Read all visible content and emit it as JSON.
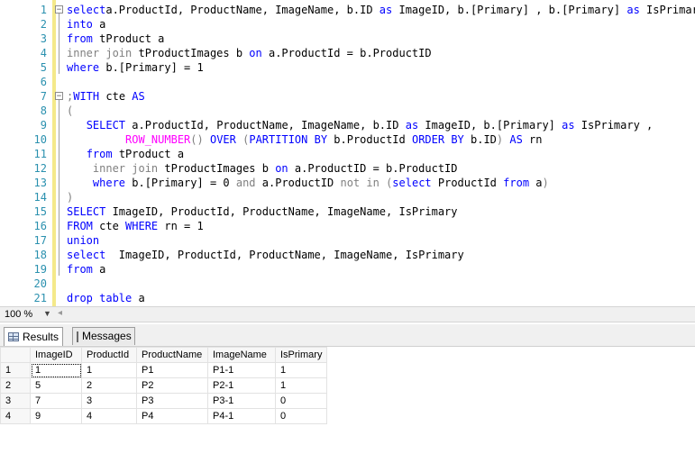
{
  "editor": {
    "lines": [
      {
        "num": "1",
        "fold": "−",
        "segs": [
          [
            "kw",
            "select"
          ],
          [
            "",
            "a.ProductId, ProductName, ImageName, b.ID "
          ],
          [
            "kw",
            "as"
          ],
          [
            "",
            " ImageID, b.[Primary] , b.[Primary] "
          ],
          [
            "kw",
            "as"
          ],
          [
            "",
            " IsPrimary"
          ]
        ]
      },
      {
        "num": "2",
        "segs": [
          [
            "kw",
            "into"
          ],
          [
            "",
            " a"
          ]
        ]
      },
      {
        "num": "3",
        "segs": [
          [
            "kw",
            "from"
          ],
          [
            "",
            " tProduct a"
          ]
        ]
      },
      {
        "num": "4",
        "segs": [
          [
            "gr",
            "inner join"
          ],
          [
            "",
            " tProductImages b "
          ],
          [
            "kw",
            "on"
          ],
          [
            "",
            " a.ProductId = b.ProductID"
          ]
        ]
      },
      {
        "num": "5",
        "segs": [
          [
            "kw",
            "where"
          ],
          [
            "",
            " b.[Primary] = 1"
          ]
        ]
      },
      {
        "num": "6",
        "segs": []
      },
      {
        "num": "7",
        "fold": "−",
        "segs": [
          [
            "gr",
            ";"
          ],
          [
            "kw",
            "WITH"
          ],
          [
            "",
            " cte "
          ],
          [
            "kw",
            "AS"
          ]
        ]
      },
      {
        "num": "8",
        "segs": [
          [
            "gr",
            "("
          ]
        ]
      },
      {
        "num": "9",
        "segs": [
          [
            "",
            "   "
          ],
          [
            "kw",
            "SELECT"
          ],
          [
            "",
            " a.ProductId, ProductName, ImageName, b.ID "
          ],
          [
            "kw",
            "as"
          ],
          [
            "",
            " ImageID, b.[Primary] "
          ],
          [
            "kw",
            "as"
          ],
          [
            "",
            " IsPrimary ,"
          ]
        ]
      },
      {
        "num": "10",
        "segs": [
          [
            "",
            "         "
          ],
          [
            "pk",
            "ROW_NUMBER"
          ],
          [
            "gr",
            "()"
          ],
          [
            "",
            " "
          ],
          [
            "kw",
            "OVER"
          ],
          [
            "",
            " "
          ],
          [
            "gr",
            "("
          ],
          [
            "kw",
            "PARTITION BY"
          ],
          [
            "",
            " b.ProductId "
          ],
          [
            "kw",
            "ORDER BY"
          ],
          [
            "",
            " b.ID"
          ],
          [
            "gr",
            ")"
          ],
          [
            "",
            " "
          ],
          [
            "kw",
            "AS"
          ],
          [
            "",
            " rn"
          ]
        ]
      },
      {
        "num": "11",
        "segs": [
          [
            "",
            "   "
          ],
          [
            "kw",
            "from"
          ],
          [
            "",
            " tProduct a"
          ]
        ]
      },
      {
        "num": "12",
        "segs": [
          [
            "",
            "    "
          ],
          [
            "gr",
            "inner join"
          ],
          [
            "",
            " tProductImages b "
          ],
          [
            "kw",
            "on"
          ],
          [
            "",
            " a.ProductID = b.ProductID"
          ]
        ]
      },
      {
        "num": "13",
        "segs": [
          [
            "",
            "    "
          ],
          [
            "kw",
            "where"
          ],
          [
            "",
            " b.[Primary] = 0 "
          ],
          [
            "gr",
            "and"
          ],
          [
            "",
            " a.ProductID "
          ],
          [
            "gr",
            "not in"
          ],
          [
            "",
            " "
          ],
          [
            "gr",
            "("
          ],
          [
            "kw",
            "select"
          ],
          [
            "",
            " ProductId "
          ],
          [
            "kw",
            "from"
          ],
          [
            "",
            " a"
          ],
          [
            "gr",
            ")"
          ]
        ]
      },
      {
        "num": "14",
        "segs": [
          [
            "gr",
            ")"
          ]
        ]
      },
      {
        "num": "15",
        "segs": [
          [
            "kw",
            "SELECT"
          ],
          [
            "",
            " ImageID, ProductId, ProductName, ImageName, IsPrimary"
          ]
        ]
      },
      {
        "num": "16",
        "segs": [
          [
            "kw",
            "FROM"
          ],
          [
            "",
            " cte "
          ],
          [
            "kw",
            "WHERE"
          ],
          [
            "",
            " rn = 1"
          ]
        ]
      },
      {
        "num": "17",
        "segs": [
          [
            "kw",
            "union"
          ]
        ]
      },
      {
        "num": "18",
        "segs": [
          [
            "kw",
            "select"
          ],
          [
            "",
            "  ImageID, ProductId, ProductName, ImageName, IsPrimary"
          ]
        ]
      },
      {
        "num": "19",
        "segs": [
          [
            "kw",
            "from"
          ],
          [
            "",
            " a"
          ]
        ]
      },
      {
        "num": "20",
        "segs": []
      },
      {
        "num": "21",
        "segs": [
          [
            "kw",
            "drop table"
          ],
          [
            "",
            " a"
          ]
        ]
      }
    ]
  },
  "status": {
    "zoom": "100 %"
  },
  "tabs": {
    "results": "Results",
    "messages": "Messages"
  },
  "results": {
    "columns": [
      "ImageID",
      "ProductId",
      "ProductName",
      "ImageName",
      "IsPrimary"
    ],
    "rows": [
      {
        "n": "1",
        "cells": [
          "1",
          "1",
          "P1",
          "P1-1",
          "1"
        ]
      },
      {
        "n": "2",
        "cells": [
          "5",
          "2",
          "P2",
          "P2-1",
          "1"
        ]
      },
      {
        "n": "3",
        "cells": [
          "7",
          "3",
          "P3",
          "P3-1",
          "0"
        ]
      },
      {
        "n": "4",
        "cells": [
          "9",
          "4",
          "P4",
          "P4-1",
          "0"
        ]
      }
    ]
  },
  "colors": {
    "keyword": "#0000ff",
    "gray": "#808080",
    "function": "#ff00ff",
    "linenum": "#2b91af",
    "changebar": "#f4e98a"
  }
}
